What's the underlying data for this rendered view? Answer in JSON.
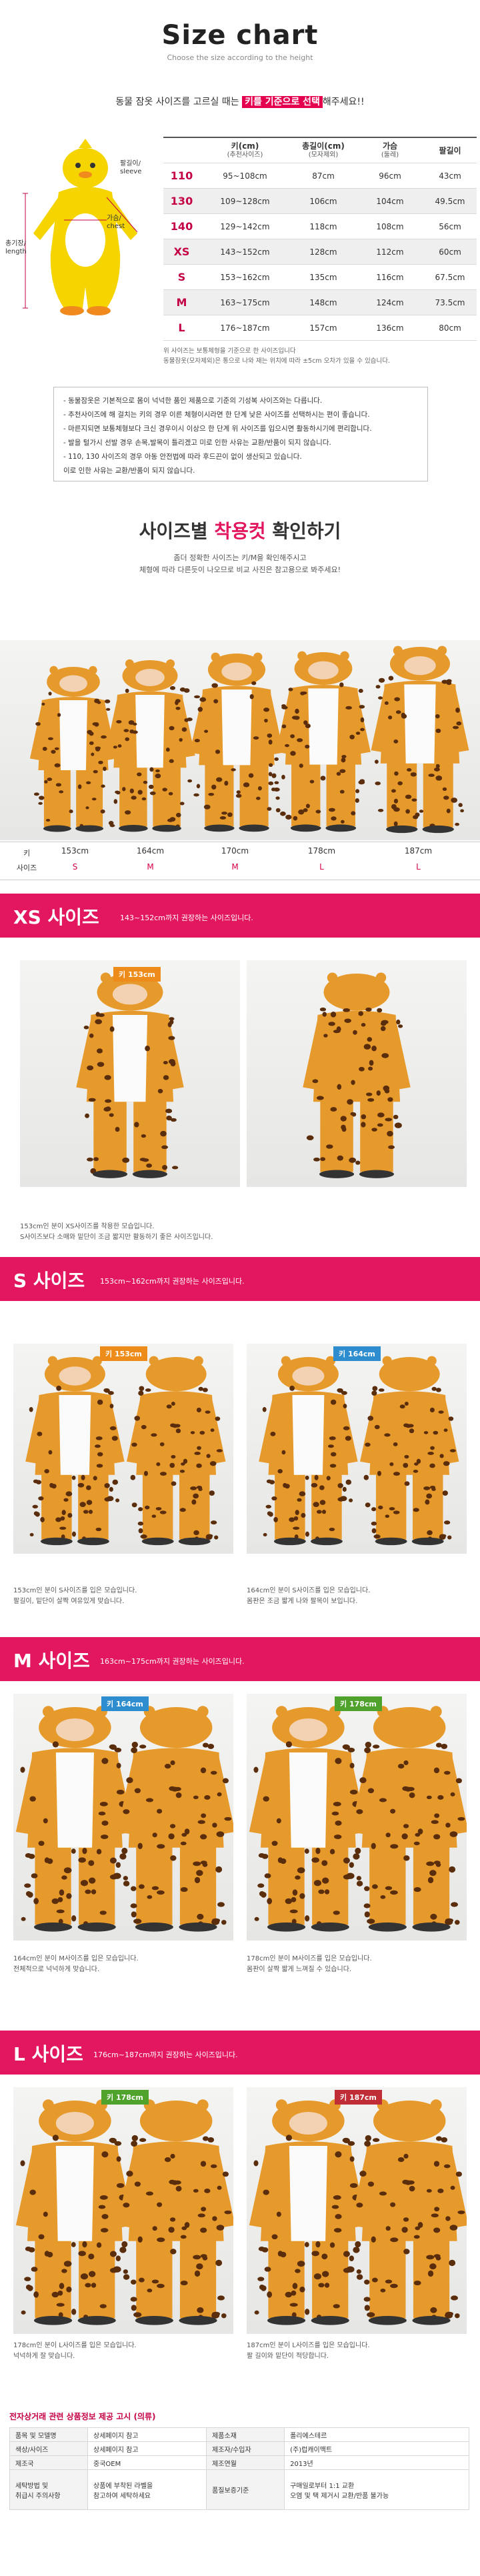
{
  "header": {
    "title": "Size chart",
    "subtitle": "Choose the size according to the height",
    "intro_prefix": "동물 잠옷 사이즈를 고르실 때는 ",
    "intro_highlight": "키를 기준으로 선택",
    "intro_suffix": "해주세요!!"
  },
  "diagram": {
    "label_sleeve": "팔길이/\nsleeve",
    "label_chest": "가슴/\nchest",
    "label_length": "총기장/\nlength"
  },
  "size_table": {
    "headers": [
      {
        "main": "키(cm)",
        "sub": "(추천사이즈)"
      },
      {
        "main": "총길이(cm)",
        "sub": "(모자제외)"
      },
      {
        "main": "가슴",
        "sub": "(둘레)"
      },
      {
        "main": "팔길이",
        "sub": ""
      }
    ],
    "rows": [
      {
        "size": "110",
        "height": "95~108cm",
        "length": "87cm",
        "chest": "96cm",
        "sleeve": "43cm"
      },
      {
        "size": "130",
        "height": "109~128cm",
        "length": "106cm",
        "chest": "104cm",
        "sleeve": "49.5cm"
      },
      {
        "size": "140",
        "height": "129~142cm",
        "length": "118cm",
        "chest": "108cm",
        "sleeve": "56cm"
      },
      {
        "size": "XS",
        "height": "143~152cm",
        "length": "128cm",
        "chest": "112cm",
        "sleeve": "60cm"
      },
      {
        "size": "S",
        "height": "153~162cm",
        "length": "135cm",
        "chest": "116cm",
        "sleeve": "67.5cm"
      },
      {
        "size": "M",
        "height": "163~175cm",
        "length": "148cm",
        "chest": "124cm",
        "sleeve": "73.5cm"
      },
      {
        "size": "L",
        "height": "176~187cm",
        "length": "157cm",
        "chest": "136cm",
        "sleeve": "80cm"
      }
    ],
    "footnote1": "위 사이즈는 보통체형을 기준으로 한 사이즈입니다",
    "footnote2": "동물잠옷(모자제외)은 통으로 나와 재는 위치에 따라 ±5cm 오차가 있을 수 있습니다."
  },
  "notes": [
    "- 동물잠옷은 기본적으로 몸이 넉넉한 품인 제품으로 기준의 기성복 사이즈와는 다릅니다.",
    "- 추천사이즈에 해 걸치는 키의 경우 이른 체형이시라면 한 단계 낮은 사이즈를 선택하시는 편이 좋습니다.",
    "- 마른지되면 보통체형보다 크신 경우이시 이상으 한 단계 위 사이즈를 입으시면 활동하시기에 편리합니다.",
    "- 발을 털가시 선발 경우 손목,발목이 틀리겠고 미로 인한 사유는 교환/반품이 되지 않습니다.",
    "- 110, 130 사이즈의 경우 아동 안전법에 따라 후드끈이 없이 생산되고 있습니다.",
    "  이로 인한 사유는 교환/반품이 되지 않습니다."
  ],
  "fitting": {
    "title_prefix": "사이즈별 ",
    "title_highlight": "착용컷",
    "title_suffix": " 확인하기",
    "desc1": "좀더 정확한 사이즈는 키/M을 확인해주시고",
    "desc2": "체형에 따라 다른듯이 나오므로 비교 사진은 참고용으로 봐주세요!",
    "row_height_label": "키",
    "row_size_label": "사이즈",
    "people": [
      {
        "height": "153cm",
        "size": "S"
      },
      {
        "height": "164cm",
        "size": "M"
      },
      {
        "height": "170cm",
        "size": "M"
      },
      {
        "height": "178cm",
        "size": "L"
      },
      {
        "height": "187cm",
        "size": "L"
      }
    ]
  },
  "sections": [
    {
      "title": "XS 사이즈",
      "desc": "143~152cm까지 권장하는 사이즈입니다.",
      "photos": [
        {
          "tag": "키 153cm",
          "color": "orange"
        }
      ],
      "captions": [
        "153cm인 분이 XS사이즈를 착용한 모습입니다.",
        "S사이즈보다 소매와 밑단이 조금 짧지만 활동하기 좋은 사이즈입니다."
      ]
    },
    {
      "title": "S 사이즈",
      "desc": "153cm~162cm까지 권장하는 사이즈입니다.",
      "photos": [
        {
          "tag": "키 153cm",
          "color": "orange"
        },
        {
          "tag": "키 164cm",
          "color": "blue"
        }
      ],
      "captions": [
        "153cm인 분이 S사이즈를 입은 모습입니다.",
        "팔길이, 밑단이 살짝 여유있게 맞습니다.",
        "164cm인 분이 S사이즈를 입은 모습입니다.",
        "몸판은 조금 짧게 나와 팔목이 보입니다."
      ]
    },
    {
      "title": "M 사이즈",
      "desc": "163cm~175cm까지 권장하는 사이즈입니다.",
      "photos": [
        {
          "tag": "키 164cm",
          "color": "blue"
        },
        {
          "tag": "키 178cm",
          "color": "green"
        }
      ],
      "captions": [
        "164cm인 분이 M사이즈를 입은 모습입니다.",
        "전체적으로 넉넉하게 맞습니다.",
        "178cm인 분이 M사이즈를 입은 모습입니다.",
        "몸판이 살짝 짧게 느껴질 수 있습니다."
      ]
    },
    {
      "title": "L 사이즈",
      "desc": "176cm~187cm까지 권장하는 사이즈입니다.",
      "photos": [
        {
          "tag": "키 178cm",
          "color": "green"
        },
        {
          "tag": "키 187cm",
          "color": "red"
        }
      ],
      "captions": [
        "178cm인 분이 L사이즈를 입은 모습입니다.",
        "넉넉하게 잘 맞습니다.",
        "187cm인 분이 L사이즈를 입은 모습입니다.",
        "팔 길이와 밑단이 적당합니다."
      ]
    }
  ],
  "info": {
    "title": "전자상거래 관련 상품정보 제공 고시 (의류)",
    "rows": [
      [
        "품목 및 모델명",
        "상세페이지 참고",
        "제품소재",
        "폴리에스테르"
      ],
      [
        "색상/사이즈",
        "상세페이지 참고",
        "제조자/수입자",
        "(주)럽캐이맥트"
      ],
      [
        "제조국",
        "중국OEM",
        "제조연월",
        "2013년"
      ],
      [
        "세탁방법 및\n취급시 주의사항",
        "상품에 부착된 라벨을\n참고하여 세탁하세요",
        "품질보증기준",
        "구매일로부터 1:1 교환\n오염 및 택 제거시 교환/반품 불가능"
      ]
    ]
  },
  "colors": {
    "accent": "#e3175f",
    "highlight": "#e4004f",
    "size_text": "#c40046"
  }
}
